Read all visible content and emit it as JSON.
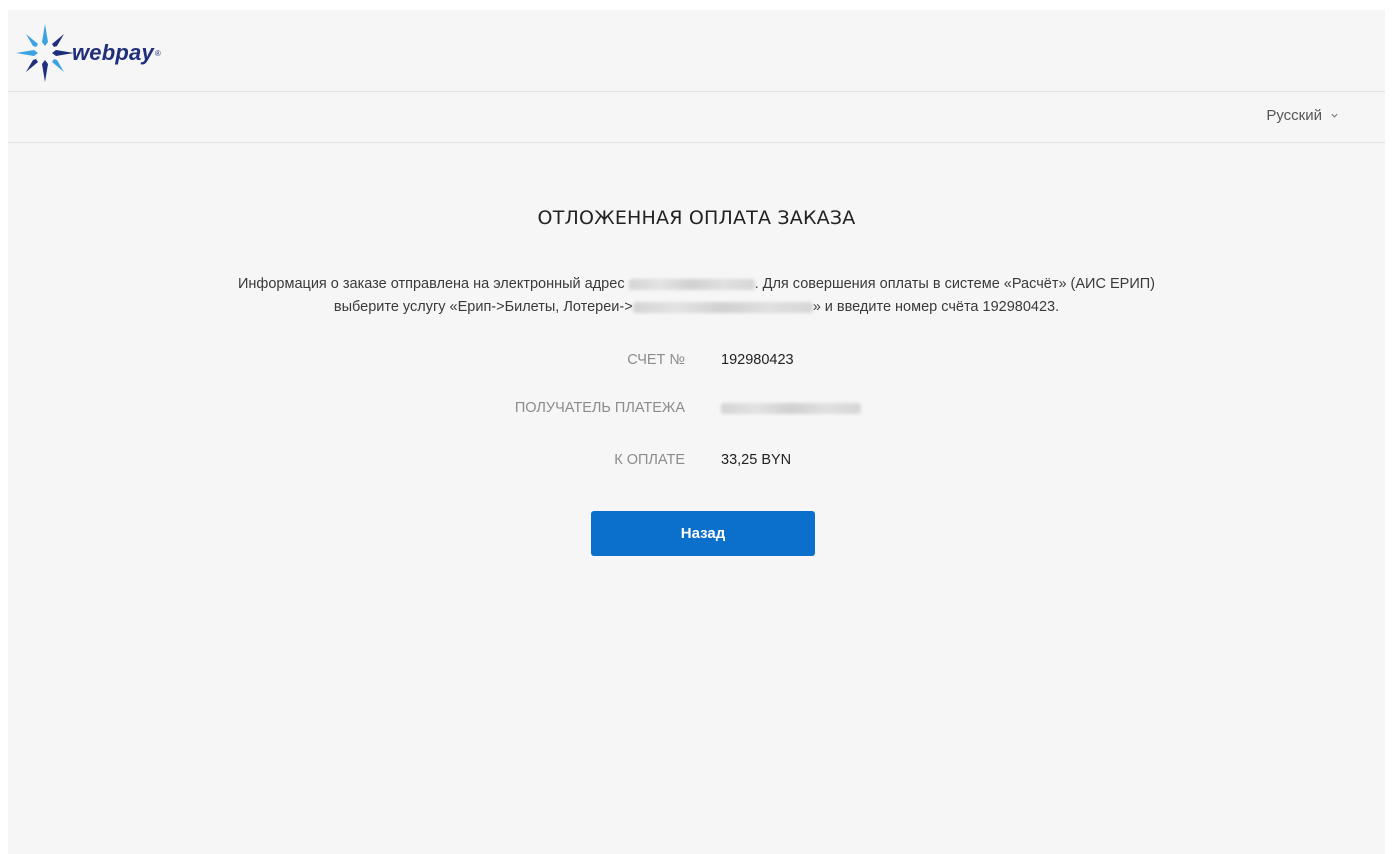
{
  "header": {
    "logo_text": "webpay",
    "logo_reg": "®"
  },
  "language": {
    "selected": "Русский"
  },
  "main": {
    "title": "ОТЛОЖЕННАЯ ОПЛАТА ЗАКАЗА",
    "info": {
      "part1": "Информация о заказе отправлена на электронный адрес ",
      "part2": ". Для совершения оплаты в системе «Расчёт» (АИС ЕРИП)",
      "part3": "выберите услугу «Ерип->Билеты, Лотереи->",
      "part4": "» и введите номер счёта 192980423."
    },
    "details": [
      {
        "label": "СЧЕТ №",
        "value": "192980423"
      },
      {
        "label": "ПОЛУЧАТЕЛЬ ПЛАТЕЖА",
        "value": ""
      },
      {
        "label": "К ОПЛАТЕ",
        "value": "33,25 BYN"
      }
    ],
    "back_button": "Назад"
  },
  "colors": {
    "accent": "#0b6fcc",
    "brand": "#1f2f7a",
    "background": "#f6f6f6"
  }
}
